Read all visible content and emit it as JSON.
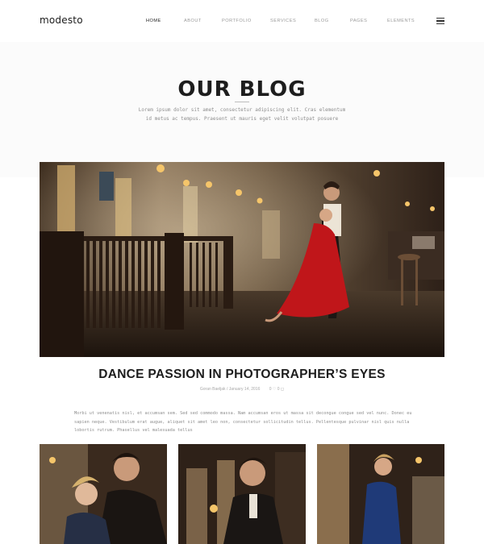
{
  "brand": {
    "logo": "modesto"
  },
  "nav": {
    "items": [
      "HOME",
      "ABOUT",
      "PORTFOLIO",
      "SERVICES",
      "BLOG",
      "PAGES",
      "ELEMENTS"
    ],
    "active": "HOME",
    "menu_icon": "hamburger-menu-icon"
  },
  "hero": {
    "title": "OUR BLOG",
    "intro": "Lorem ipsum dolor sit amet, consectetur adipiscing elit. Cras elementum id metus ac tempus. Praesent ut mauris eget velit volutpat posuere"
  },
  "post": {
    "title": "DANCE PASSION IN PHOTOGRAPHER’S EYES",
    "author": "Goran Baeljak",
    "date": "January 14, 2016",
    "likes": "0",
    "comments": "0",
    "excerpt": "Morbi ut venenatis nisl, et accumsan sem. Sed sed commodo massa. Nam accumsan eros ut massa sit decongue congue sed vel nunc. Donec eu sapien neque. Vestibulum erat augue, aliquet sit amet leo non, consectetur sollicitudin tellus. Pellentesque pulvinar nisl quis nulla lobortis rutrum. Phasellus vel malesuada tellus"
  },
  "colors": {
    "dress_red": "#c0161a",
    "warm_light": "#f5c56a",
    "dark_wood": "#2b1d14"
  }
}
